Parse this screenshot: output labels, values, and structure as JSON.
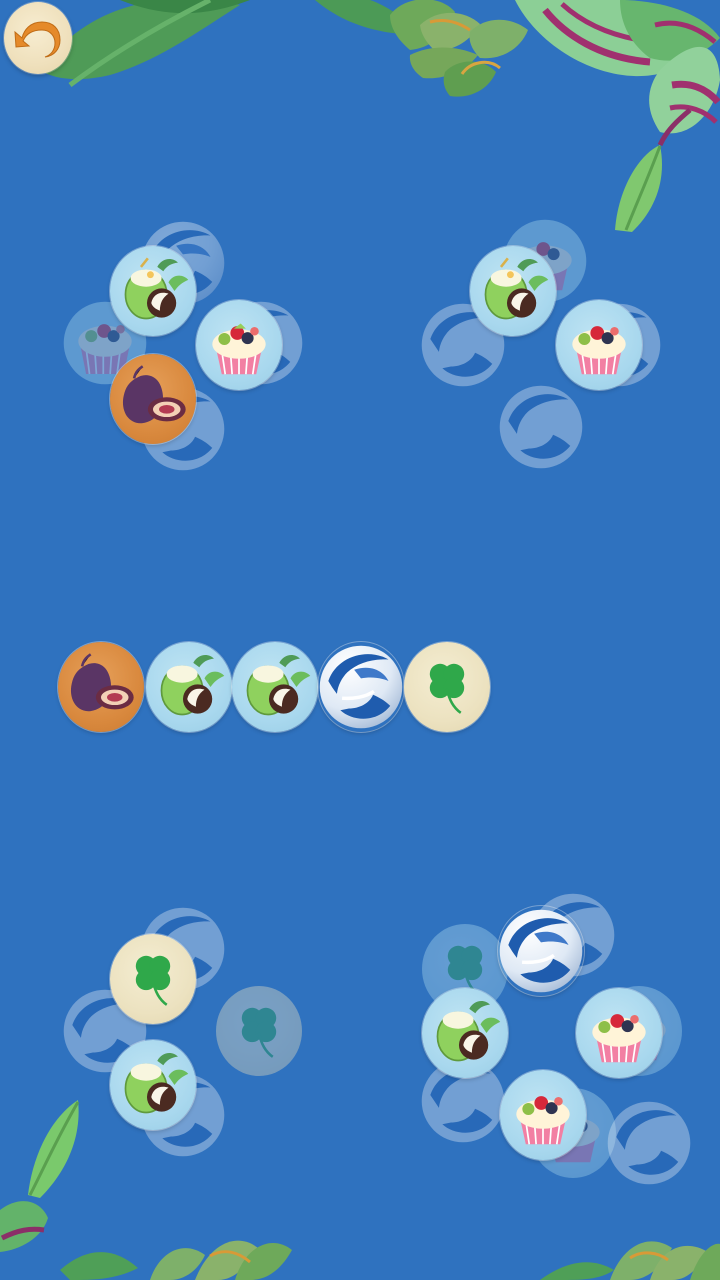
{
  "game": {
    "background_color": "#2f72bf",
    "back_button": {
      "icon": "back-arrow-icon",
      "color": "#e58a2a"
    },
    "tile_types": {
      "coconut": "coconut-icon",
      "cupcake": "cupcake-icon",
      "fig": "fig-icon",
      "clover": "clover-icon",
      "sphere": "blue-swirl-sphere-icon"
    },
    "tray": {
      "capacity": 7,
      "tiles": [
        "fig",
        "coconut",
        "coconut",
        "sphere",
        "clover"
      ]
    },
    "clusters": [
      {
        "name": "top-left",
        "active_tiles": [
          "coconut",
          "cupcake",
          "fig"
        ],
        "hidden_tiles": [
          "sphere",
          "cupcake",
          "sphere",
          "sphere"
        ]
      },
      {
        "name": "top-right",
        "active_tiles": [
          "coconut",
          "cupcake"
        ],
        "hidden_tiles": [
          "cupcake",
          "sphere",
          "sphere",
          "sphere"
        ]
      },
      {
        "name": "bottom-left",
        "active_tiles": [
          "clover",
          "coconut"
        ],
        "hidden_tiles": [
          "sphere",
          "sphere",
          "clover",
          "sphere"
        ]
      },
      {
        "name": "bottom-right",
        "active_tiles": [
          "sphere",
          "coconut",
          "cupcake",
          "cupcake"
        ],
        "hidden_tiles": [
          "sphere",
          "clover",
          "cupcake",
          "sphere",
          "cupcake",
          "sphere"
        ]
      }
    ]
  }
}
